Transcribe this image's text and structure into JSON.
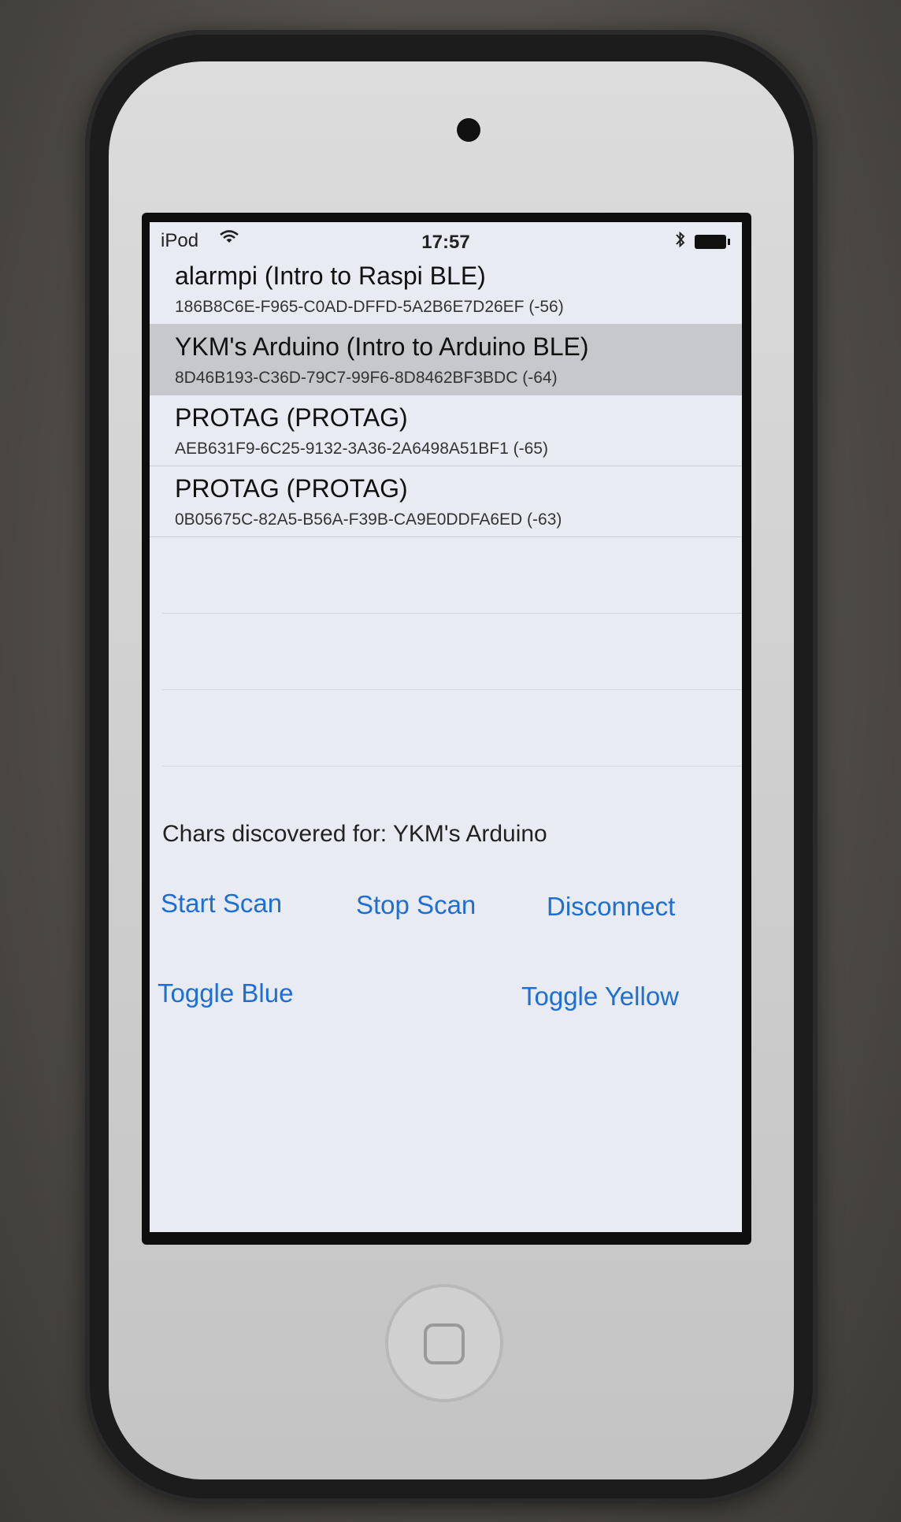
{
  "status_bar": {
    "carrier": "iPod",
    "time": "17:57"
  },
  "devices": [
    {
      "name": "alarmpi (Intro to Raspi BLE)",
      "id": "186B8C6E-F965-C0AD-DFFD-5A2B6E7D26EF (-56)",
      "selected": false
    },
    {
      "name": "YKM's Arduino (Intro to Arduino BLE)",
      "id": "8D46B193-C36D-79C7-99F6-8D8462BF3BDC (-64)",
      "selected": true
    },
    {
      "name": "PROTAG (PROTAG)",
      "id": "AEB631F9-6C25-9132-3A36-2A6498A51BF1 (-65)",
      "selected": false
    },
    {
      "name": "PROTAG (PROTAG)",
      "id": "0B05675C-82A5-B56A-F39B-CA9E0DDFA6ED (-63)",
      "selected": false
    }
  ],
  "chars_label": "Chars discovered for: YKM's Arduino",
  "buttons": {
    "start_scan": "Start Scan",
    "stop_scan": "Stop Scan",
    "disconnect": "Disconnect",
    "toggle_blue": "Toggle Blue",
    "toggle_yellow": "Toggle Yellow"
  },
  "colors": {
    "link": "#1f6ed4",
    "selected_row": "#c6c8cb",
    "screen_bg": "#e8ecf2"
  },
  "icons": [
    "wifi-icon",
    "bluetooth-icon",
    "battery-icon"
  ]
}
